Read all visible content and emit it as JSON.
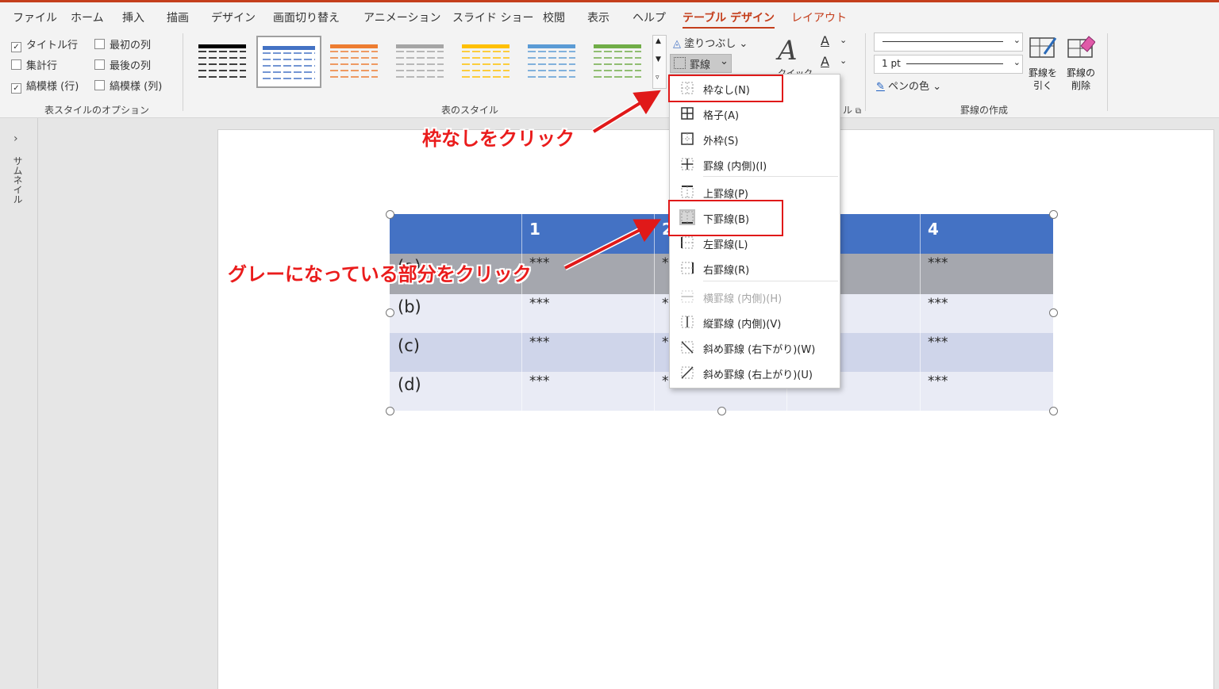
{
  "tabs": [
    "ファイル",
    "ホーム",
    "挿入",
    "描画",
    "デザイン",
    "画面切り替え",
    "アニメーション",
    "スライド ショー",
    "校閲",
    "表示",
    "ヘルプ",
    "テーブル デザイン",
    "レイアウト"
  ],
  "style_options": {
    "header_row": "タイトル行",
    "total_row": "集計行",
    "banded_rows": "縞模様 (行)",
    "first_column": "最初の列",
    "last_column": "最後の列",
    "banded_columns": "縞模様 (列)",
    "group_label": "表スタイルのオプション"
  },
  "table_styles": {
    "group_label": "表のスタイル",
    "colors": [
      "#000000",
      "#4472c4",
      "#ed7d31",
      "#a5a5a5",
      "#ffc000",
      "#5b9bd5",
      "#70ad47"
    ]
  },
  "fill_label": "塗りつぶし",
  "borders_label": "罫線",
  "quick_label": "クイック",
  "wordart_group_fragment": "ル",
  "pen_weight": "1 pt",
  "pen_color_label": "ペンの色",
  "draw_table_label": "罫線を引く",
  "eraser_label": "罫線の削除",
  "draw_group_label": "罫線の作成",
  "sidebar_label": "サムネイル",
  "table": {
    "header": [
      "",
      "1",
      "2",
      "",
      "4"
    ],
    "rows": [
      {
        "label": "(a)",
        "cells": [
          "***",
          "***",
          "",
          "***"
        ]
      },
      {
        "label": "(b)",
        "cells": [
          "***",
          "***",
          "",
          "***"
        ]
      },
      {
        "label": "(c)",
        "cells": [
          "***",
          "***",
          "",
          "***"
        ]
      },
      {
        "label": "(d)",
        "cells": [
          "***",
          "***",
          "",
          "***"
        ]
      }
    ]
  },
  "borders_menu": [
    {
      "label": "枠なし(N)",
      "icon": "no-border-icon"
    },
    {
      "label": "格子(A)",
      "icon": "all-borders-icon"
    },
    {
      "label": "外枠(S)",
      "icon": "outside-borders-icon"
    },
    {
      "label": "罫線 (内側)(I)",
      "icon": "inside-borders-icon"
    },
    {
      "label": "上罫線(P)",
      "icon": "top-border-icon"
    },
    {
      "label": "下罫線(B)",
      "icon": "bottom-border-icon"
    },
    {
      "label": "左罫線(L)",
      "icon": "left-border-icon"
    },
    {
      "label": "右罫線(R)",
      "icon": "right-border-icon"
    },
    {
      "label": "横罫線 (内側)(H)",
      "icon": "inside-horizontal-border-icon",
      "disabled": true
    },
    {
      "label": "縦罫線 (内側)(V)",
      "icon": "inside-vertical-border-icon"
    },
    {
      "label": "斜め罫線 (右下がり)(W)",
      "icon": "diagonal-down-border-icon"
    },
    {
      "label": "斜め罫線 (右上がり)(U)",
      "icon": "diagonal-up-border-icon"
    }
  ],
  "annotations": {
    "click_no_border": "枠なしをクリック",
    "click_gray": "グレーになっている部分をクリック"
  },
  "colors": {
    "accent": "#c43e1c",
    "header_blue": "#4472c4",
    "gray_row": "#a5a7ae",
    "band_light": "#e9ebf5",
    "band_mid": "#cfd5ea",
    "annotation_red": "#ea1c1c"
  }
}
